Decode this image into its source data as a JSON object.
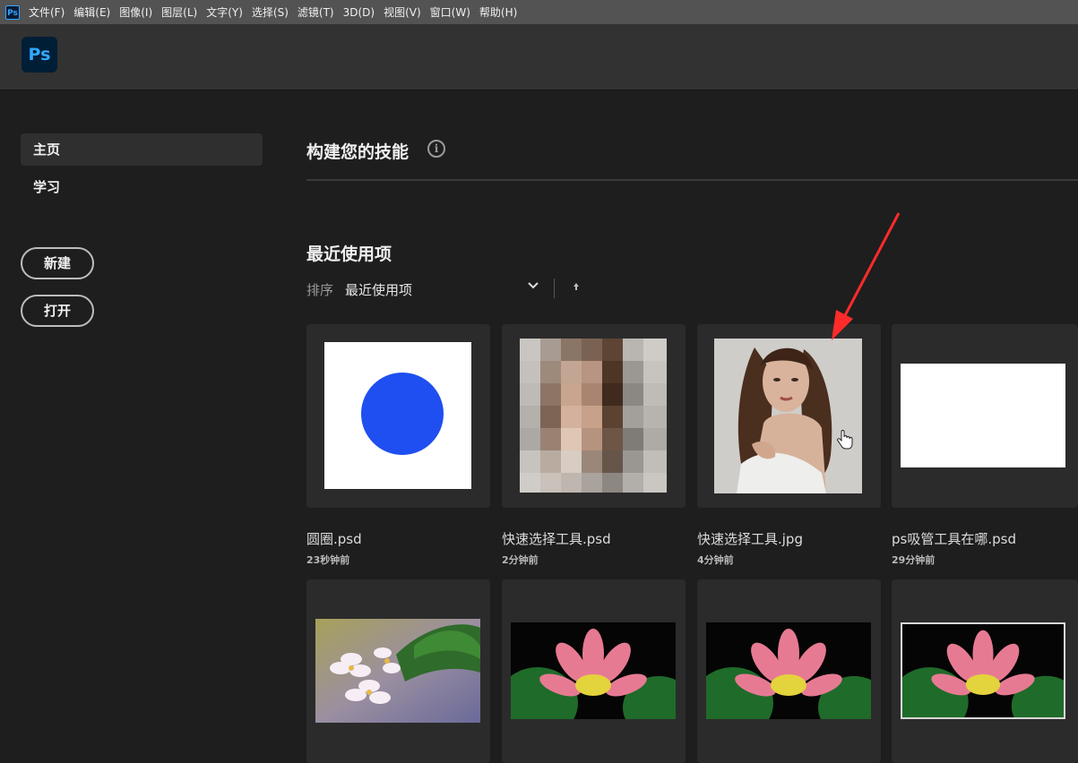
{
  "menubar": {
    "app_icon": "Ps",
    "items": [
      "文件(F)",
      "编辑(E)",
      "图像(I)",
      "图层(L)",
      "文字(Y)",
      "选择(S)",
      "滤镜(T)",
      "3D(D)",
      "视图(V)",
      "窗口(W)",
      "帮助(H)"
    ]
  },
  "header": {
    "logo": "Ps"
  },
  "sidebar": {
    "items": [
      {
        "label": "主页",
        "active": true
      },
      {
        "label": "学习",
        "active": false
      }
    ],
    "new_button": "新建",
    "open_button": "打开"
  },
  "main": {
    "skills_title": "构建您的技能",
    "info_icon_glyph": "i",
    "recent_title": "最近使用项",
    "sort_label": "排序",
    "sort_value": "最近使用项",
    "recent_files": [
      {
        "name": "圆圈.psd",
        "time": "23秒钟前",
        "thumb": "blue-circle"
      },
      {
        "name": "快速选择工具.psd",
        "time": "2分钟前",
        "thumb": "pixelated-portrait"
      },
      {
        "name": "快速选择工具.jpg",
        "time": "4分钟前",
        "thumb": "portrait-photo"
      },
      {
        "name": "ps吸管工具在哪.psd",
        "time": "29分钟前",
        "thumb": "white-rectangle"
      },
      {
        "name": "",
        "time": "",
        "thumb": "plumeria-flowers"
      },
      {
        "name": "",
        "time": "",
        "thumb": "lotus-flower"
      },
      {
        "name": "",
        "time": "",
        "thumb": "lotus-flower"
      },
      {
        "name": "",
        "time": "",
        "thumb": "lotus-flower-bordered"
      }
    ]
  },
  "colors": {
    "accent_blue": "#1f4ff0",
    "ps_blue": "#31a8ff",
    "annotation_red": "#ff2b2b"
  }
}
